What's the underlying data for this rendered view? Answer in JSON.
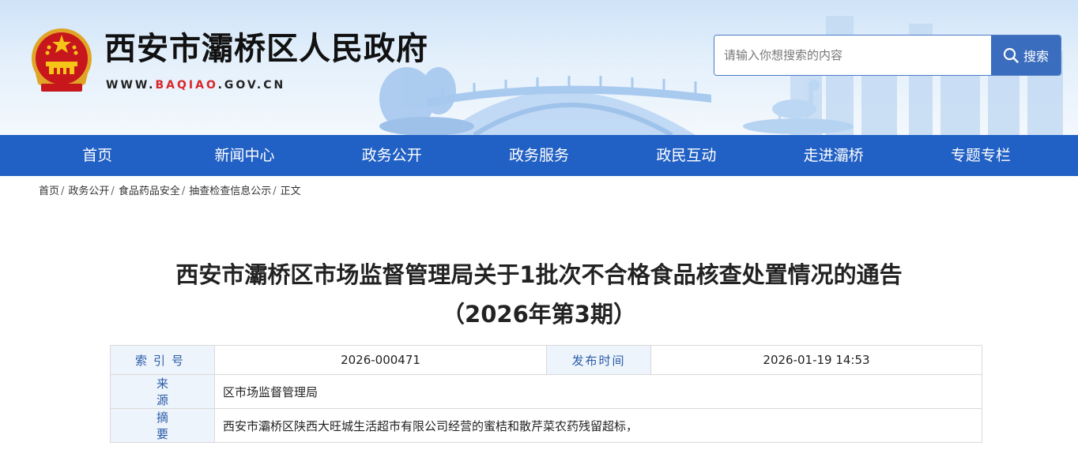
{
  "header": {
    "site_title": "西安市灞桥区人民政府",
    "site_url_prefix": "WWW.",
    "site_url_highlight": "BAQIAO",
    "site_url_suffix": ".GOV.CN",
    "search": {
      "placeholder": "请输入你想搜索的内容",
      "value": "",
      "button_label": "搜索"
    }
  },
  "nav": {
    "items": [
      {
        "label": "首页"
      },
      {
        "label": "新闻中心"
      },
      {
        "label": "政务公开"
      },
      {
        "label": "政务服务"
      },
      {
        "label": "政民互动"
      },
      {
        "label": "走进灞桥"
      },
      {
        "label": "专题专栏"
      }
    ]
  },
  "breadcrumb": {
    "items": [
      {
        "label": "首页"
      },
      {
        "label": "政务公开"
      },
      {
        "label": "食品药品安全"
      },
      {
        "label": "抽查检查信息公示"
      }
    ],
    "separator": "/",
    "current": "正文"
  },
  "article": {
    "title_line1": "西安市灞桥区市场监督管理局关于1批次不合格食品核查处置情况的通告",
    "title_line2": "（2026年第3期）"
  },
  "info": {
    "index_label": "索引号",
    "index_value": "2026-000471",
    "date_label": "发布时间",
    "date_value": "2026-01-19 14:53",
    "source_label": "来源",
    "source_value": "区市场监督管理局",
    "summary_label": "摘要",
    "summary_value": "西安市灞桥区陕西大旺城生活超市有限公司经营的蜜桔和散芹菜农药残留超标，"
  },
  "colors": {
    "nav_bg": "#2160c4",
    "search_button_bg": "#3b6dbe",
    "label_text": "#2a5ba8",
    "label_bg": "#eef4fb",
    "url_highlight": "#d8262b"
  },
  "icons": {
    "emblem": "national-emblem-icon",
    "search": "search-icon"
  }
}
